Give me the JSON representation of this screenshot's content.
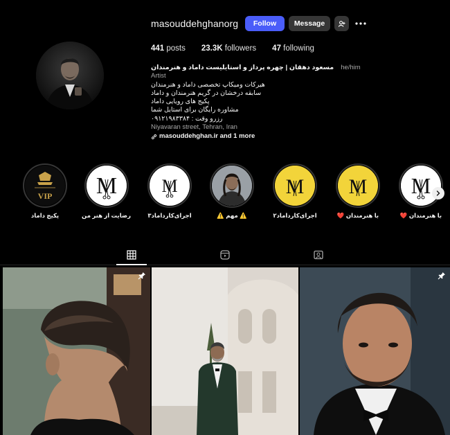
{
  "profile": {
    "username": "masouddehghanorg",
    "follow_label": "Follow",
    "message_label": "Message",
    "add_user_icon": "person-add-icon",
    "more_icon": "more-horizontal-icon",
    "stats": {
      "posts_count": "441",
      "posts_label": "posts",
      "followers_count": "23.3K",
      "followers_label": "followers",
      "following_count": "47",
      "following_label": "following"
    },
    "bio": {
      "name": "مسعود دهقان | چهره پرداز و استایلیست داماد و هنرمندان",
      "pronouns": "he/him",
      "category": "Artist",
      "lines": [
        "هیرکات ومیکاپ تخصصی داماد و هنرمندان",
        "سابقه درخشان در گریم هنرمندان و داماد",
        "پکیج های رویایی داماد",
        "مشاوره رایگان برای استایل شما",
        "رزرو وقت : ۰۹۱۲۱۹۸۳۳۸۴"
      ],
      "address": "Niyavaran street, Tehran, Iran",
      "link": "masouddehghan.ir and 1 more"
    }
  },
  "highlights": [
    {
      "label": "پکیج داماد",
      "icon": "vip-logo-icon"
    },
    {
      "label": "رضایت از هنر من",
      "icon": "m-scissors-logo-icon"
    },
    {
      "label": "اجرای‌کارداماد۳",
      "icon": "m-scissors-logo-icon"
    },
    {
      "label": "⚠️ مهم ⚠️",
      "icon": "portrait-photo-icon"
    },
    {
      "label": "اجرای‌کارداماد۲",
      "icon": "m-scissors-yellow-logo-icon"
    },
    {
      "label": "با هنرمندان ❤️",
      "icon": "m-scissors-yellow-logo-icon"
    },
    {
      "label": "با هنرمندان ❤️",
      "icon": "m-scissors-logo-icon"
    }
  ],
  "highlights_next_icon": "chevron-right-icon",
  "tabs": [
    {
      "name": "posts",
      "icon": "grid-icon",
      "active": true
    },
    {
      "name": "reels",
      "icon": "reels-icon",
      "active": false
    },
    {
      "name": "tagged",
      "icon": "tagged-icon",
      "active": false
    }
  ],
  "posts": [
    {
      "subject": "hairstyle-side-profile",
      "pinned": true,
      "pin_icon": "pin-icon"
    },
    {
      "subject": "groom-in-green-tuxedo",
      "pinned": true,
      "pin_icon": "pin-icon"
    },
    {
      "subject": "groom-portrait-bowtie",
      "pinned": true,
      "pin_icon": "pin-icon"
    }
  ],
  "colors": {
    "background": "#000000",
    "follow_button": "#4a5df9",
    "secondary_button": "#363636",
    "muted_text": "#a8a8a8"
  }
}
